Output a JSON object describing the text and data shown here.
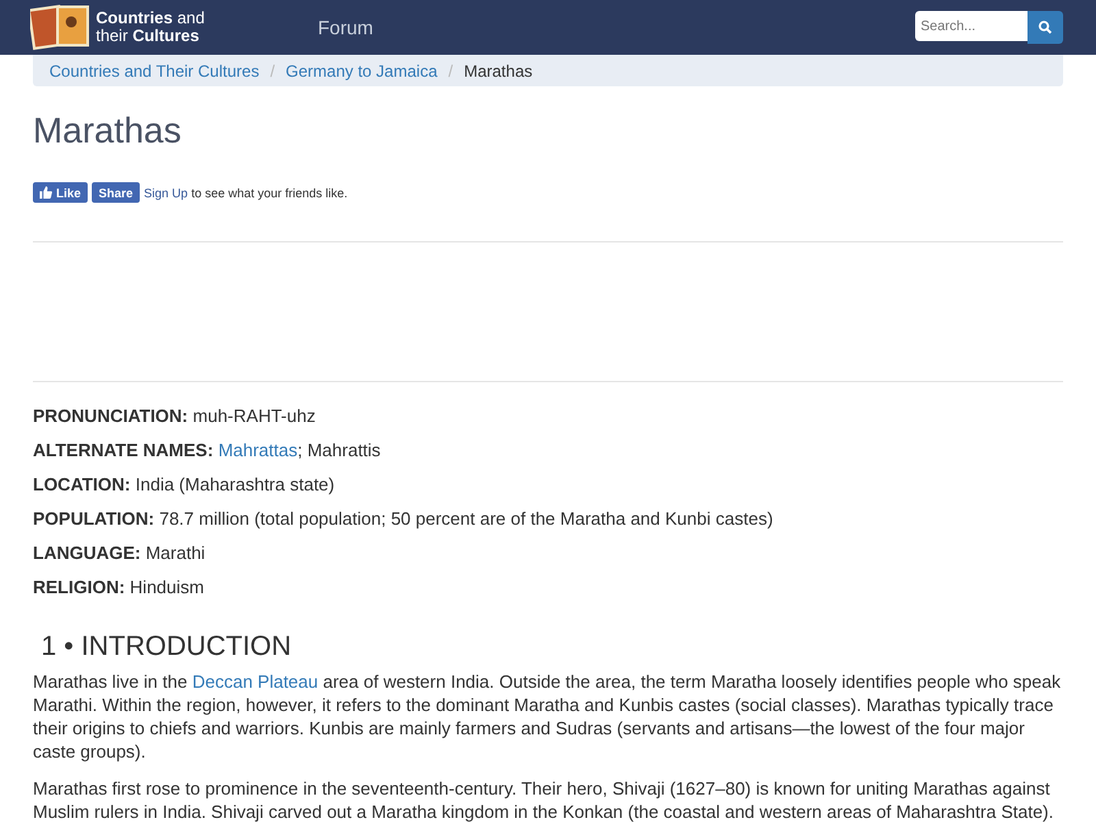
{
  "navbar": {
    "logo": {
      "line1_bold": "Countries",
      "line1_rest": "and",
      "line2_rest": "their",
      "line2_bold": "Cultures"
    },
    "links": [
      "Forum"
    ],
    "search": {
      "placeholder": "Search..."
    }
  },
  "breadcrumb_separator": "/",
  "breadcrumb": [
    {
      "label": "Countries and Their Cultures",
      "current": false
    },
    {
      "label": "Germany to Jamaica",
      "current": false
    },
    {
      "label": "Marathas",
      "current": true
    }
  ],
  "title": "Marathas",
  "social": {
    "like": "Like",
    "share": "Share",
    "signup": "Sign Up",
    "text": "to see what your friends like."
  },
  "facts": [
    {
      "label": "PRONUNCIATION:",
      "parts": [
        {
          "text": "muh-RAHT-uhz"
        }
      ]
    },
    {
      "label": "ALTERNATE NAMES:",
      "parts": [
        {
          "link": "Mahrattas"
        },
        {
          "text": "; Mahrattis"
        }
      ]
    },
    {
      "label": "LOCATION:",
      "parts": [
        {
          "text": "India (Maharashtra state)"
        }
      ]
    },
    {
      "label": "POPULATION:",
      "parts": [
        {
          "text": "78.7 million (total population; 50 percent are of the Maratha and Kunbi castes)"
        }
      ]
    },
    {
      "label": "LANGUAGE:",
      "parts": [
        {
          "text": "Marathi"
        }
      ]
    },
    {
      "label": "RELIGION:",
      "parts": [
        {
          "text": "Hinduism"
        }
      ]
    }
  ],
  "section": {
    "heading": "1 • INTRODUCTION",
    "paragraphs": [
      [
        {
          "text": "Marathas live in the "
        },
        {
          "link": "Deccan Plateau"
        },
        {
          "text": " area of western India. Outside the area, the term Maratha loosely identifies people who speak Marathi. Within the region, however, it refers to the dominant Maratha and Kunbis castes (social classes). Marathas typically trace their origins to chiefs and warriors. Kunbis are mainly farmers and Sudras (servants and artisans—the lowest of the four major caste groups)."
        }
      ],
      [
        {
          "text": "Marathas first rose to prominence in the seventeenth-century. Their hero, Shivaji (1627–80) is known for uniting Marathas against Muslim rulers in India. Shivaji carved out a Maratha kingdom in the Konkan (the coastal and western areas of Maharashtra State)."
        }
      ]
    ]
  }
}
